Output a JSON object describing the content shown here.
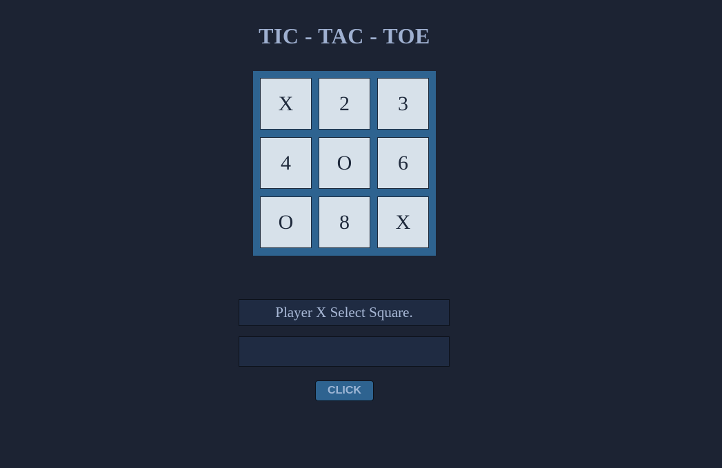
{
  "header": {
    "title": "TIC - TAC - TOE"
  },
  "board": {
    "cells": [
      {
        "label": "X"
      },
      {
        "label": "2"
      },
      {
        "label": "3"
      },
      {
        "label": "4"
      },
      {
        "label": "O"
      },
      {
        "label": "6"
      },
      {
        "label": "O"
      },
      {
        "label": "8"
      },
      {
        "label": "X"
      }
    ]
  },
  "status": {
    "message": "Player X Select Square."
  },
  "input": {
    "value": "",
    "placeholder": ""
  },
  "controls": {
    "click_label": "CLICK"
  },
  "colors": {
    "background": "#1c2333",
    "board": "#2e6390",
    "cell": "#d7e1ea",
    "title": "#9fb0d0"
  }
}
